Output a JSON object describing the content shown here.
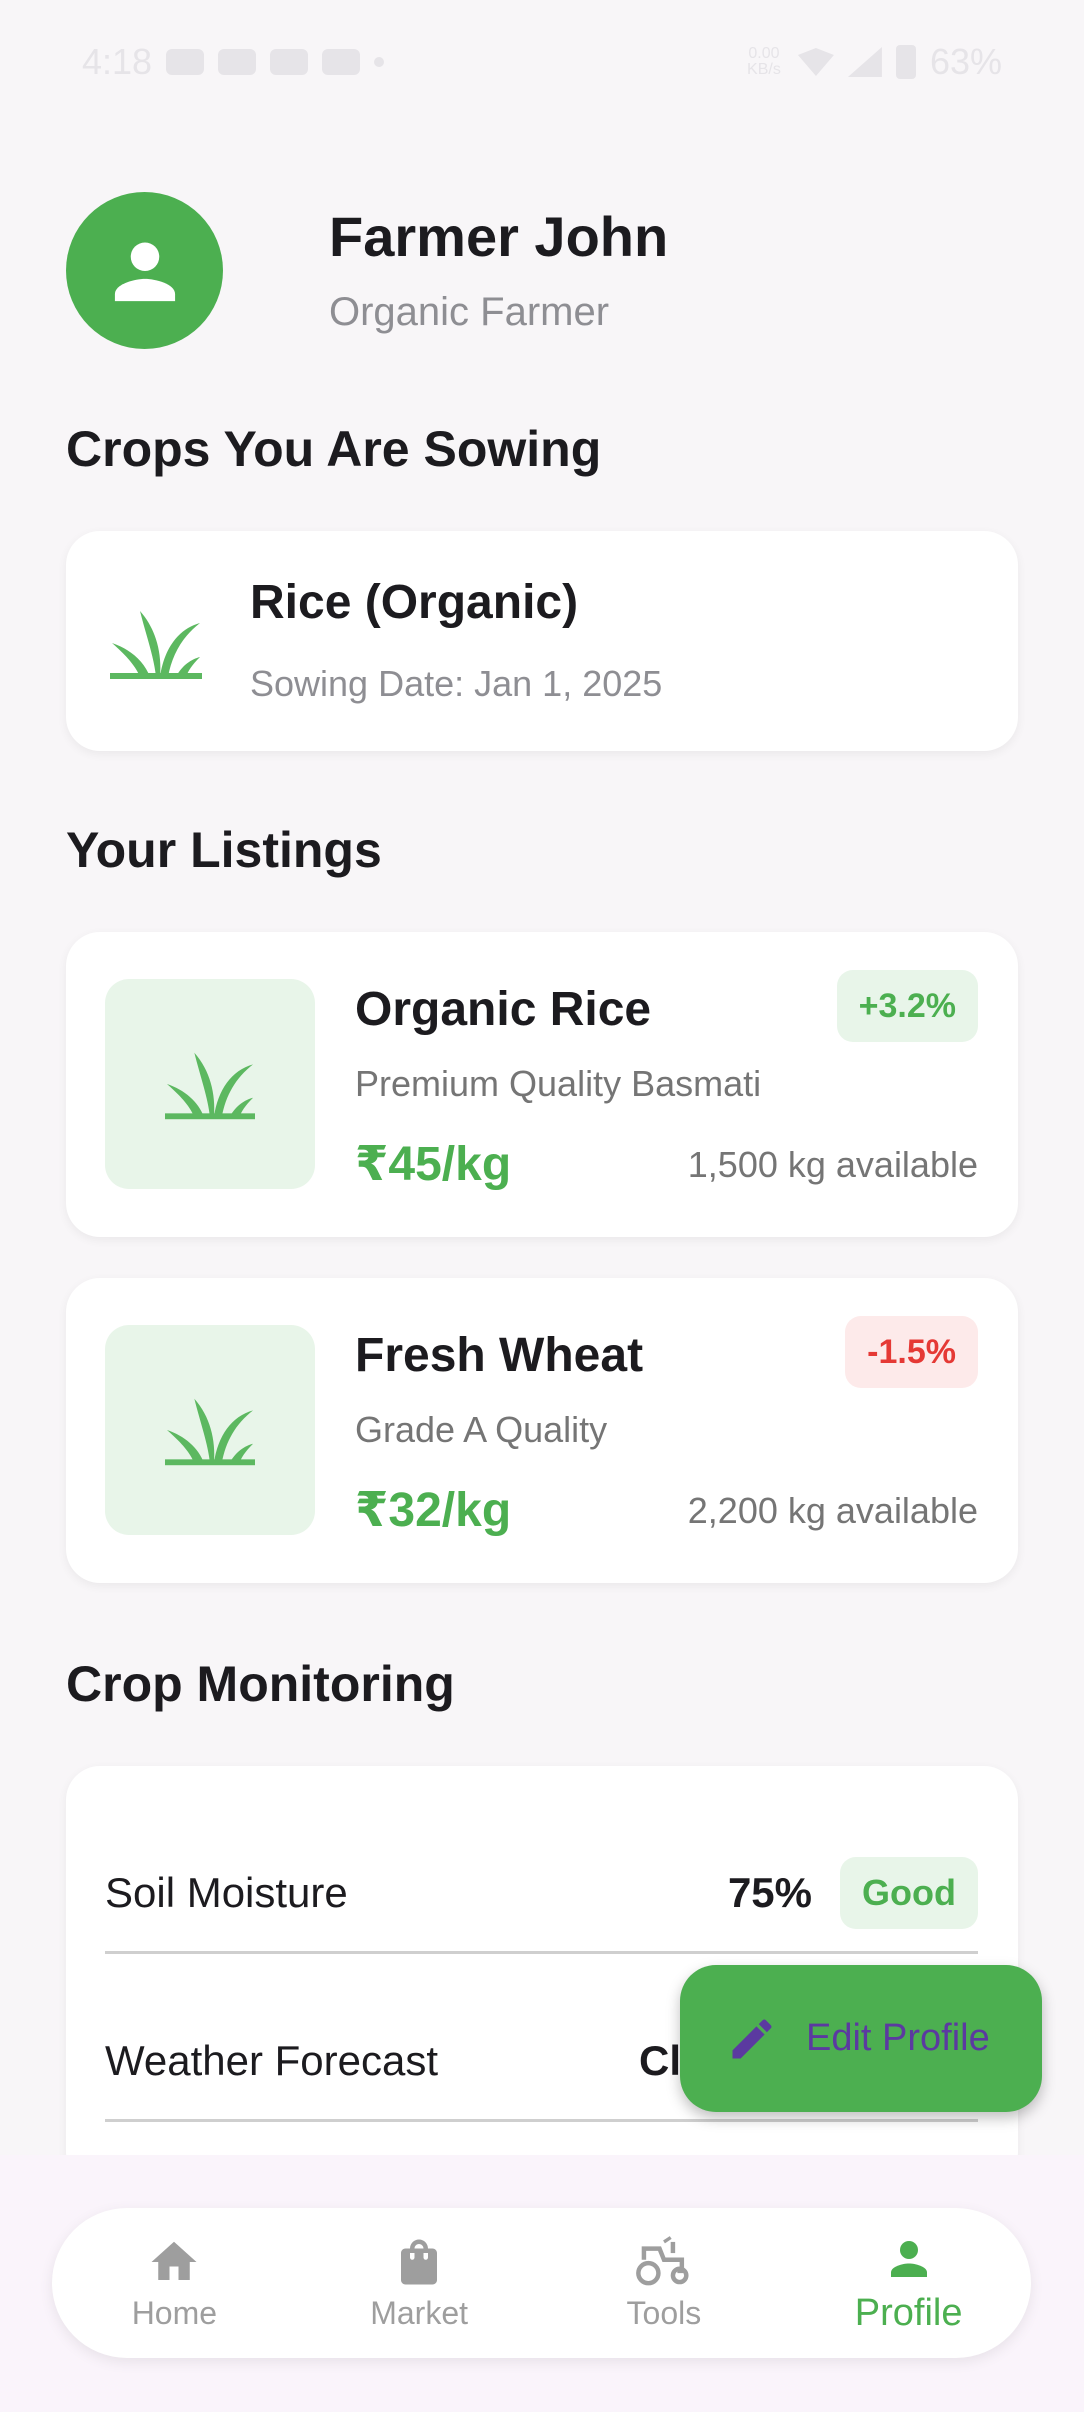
{
  "status_bar": {
    "time": "4:18",
    "speed": "0.00 KB/s",
    "battery": "63%"
  },
  "profile": {
    "name": "Farmer John",
    "role": "Organic Farmer"
  },
  "sowing_section": {
    "title": "Crops You Are Sowing",
    "crop": {
      "name": "Rice (Organic)",
      "date": "Sowing Date: Jan 1, 2025",
      "icon": "grass-icon"
    }
  },
  "listings_section": {
    "title": "Your Listings",
    "items": [
      {
        "name": "Organic Rice",
        "description": "Premium Quality Basmati",
        "price": "₹45/kg",
        "quantity": "1,500 kg available",
        "change": "+3.2%",
        "trend": "up"
      },
      {
        "name": "Fresh Wheat",
        "description": "Grade A Quality",
        "price": "₹32/kg",
        "quantity": "2,200 kg available",
        "change": "-1.5%",
        "trend": "down"
      }
    ]
  },
  "monitoring_section": {
    "title": "Crop Monitoring",
    "rows": [
      {
        "label": "Soil Moisture",
        "value": "75%",
        "status": "Good"
      },
      {
        "label": "Weather Forecast",
        "value": "Cl"
      }
    ]
  },
  "fab": {
    "label": "Edit Profile",
    "icon": "pencil-icon"
  },
  "bottom_nav": {
    "items": [
      {
        "label": "Home",
        "icon": "home-icon"
      },
      {
        "label": "Market",
        "icon": "shopping-bag-icon"
      },
      {
        "label": "Tools",
        "icon": "tractor-icon"
      },
      {
        "label": "Profile",
        "icon": "person-icon",
        "active": true
      }
    ]
  },
  "colors": {
    "accent": "#4caf50",
    "accent_light": "#e8f5e9",
    "negative": "#e53935",
    "fab_text": "#5b3aa0"
  }
}
